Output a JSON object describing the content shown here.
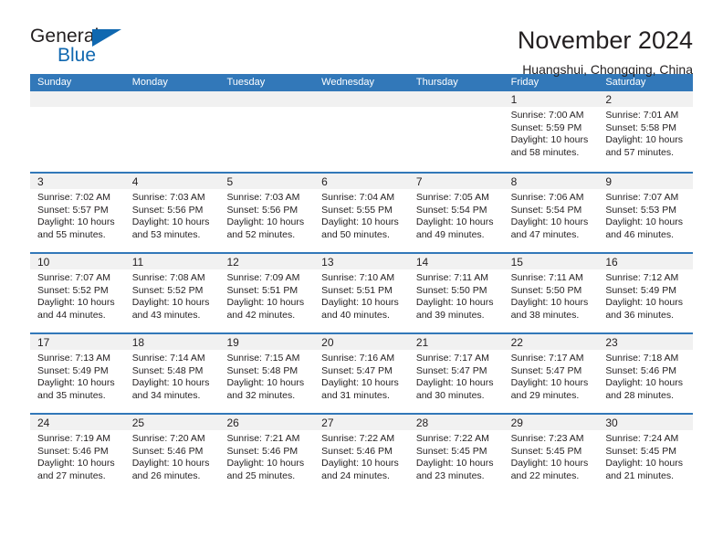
{
  "logo": {
    "line1": "General",
    "line2": "Blue",
    "triangle_icon": "blue-triangle-icon",
    "accent_color": "#1068b0"
  },
  "header": {
    "title": "November 2024",
    "location": "Huangshui, Chongqing, China"
  },
  "calendar": {
    "header_color": "#3278b9",
    "day_band_color": "#f1f1f1",
    "weekdays": [
      "Sunday",
      "Monday",
      "Tuesday",
      "Wednesday",
      "Thursday",
      "Friday",
      "Saturday"
    ],
    "labels": {
      "sunrise": "Sunrise:",
      "sunset": "Sunset:",
      "daylight": "Daylight:"
    },
    "weeks": [
      [
        {
          "day": "",
          "sunrise": "",
          "sunset": "",
          "daylight_line1": "",
          "daylight_line2": ""
        },
        {
          "day": "",
          "sunrise": "",
          "sunset": "",
          "daylight_line1": "",
          "daylight_line2": ""
        },
        {
          "day": "",
          "sunrise": "",
          "sunset": "",
          "daylight_line1": "",
          "daylight_line2": ""
        },
        {
          "day": "",
          "sunrise": "",
          "sunset": "",
          "daylight_line1": "",
          "daylight_line2": ""
        },
        {
          "day": "",
          "sunrise": "",
          "sunset": "",
          "daylight_line1": "",
          "daylight_line2": ""
        },
        {
          "day": "1",
          "sunrise": "Sunrise: 7:00 AM",
          "sunset": "Sunset: 5:59 PM",
          "daylight_line1": "Daylight: 10 hours",
          "daylight_line2": "and 58 minutes."
        },
        {
          "day": "2",
          "sunrise": "Sunrise: 7:01 AM",
          "sunset": "Sunset: 5:58 PM",
          "daylight_line1": "Daylight: 10 hours",
          "daylight_line2": "and 57 minutes."
        }
      ],
      [
        {
          "day": "3",
          "sunrise": "Sunrise: 7:02 AM",
          "sunset": "Sunset: 5:57 PM",
          "daylight_line1": "Daylight: 10 hours",
          "daylight_line2": "and 55 minutes."
        },
        {
          "day": "4",
          "sunrise": "Sunrise: 7:03 AM",
          "sunset": "Sunset: 5:56 PM",
          "daylight_line1": "Daylight: 10 hours",
          "daylight_line2": "and 53 minutes."
        },
        {
          "day": "5",
          "sunrise": "Sunrise: 7:03 AM",
          "sunset": "Sunset: 5:56 PM",
          "daylight_line1": "Daylight: 10 hours",
          "daylight_line2": "and 52 minutes."
        },
        {
          "day": "6",
          "sunrise": "Sunrise: 7:04 AM",
          "sunset": "Sunset: 5:55 PM",
          "daylight_line1": "Daylight: 10 hours",
          "daylight_line2": "and 50 minutes."
        },
        {
          "day": "7",
          "sunrise": "Sunrise: 7:05 AM",
          "sunset": "Sunset: 5:54 PM",
          "daylight_line1": "Daylight: 10 hours",
          "daylight_line2": "and 49 minutes."
        },
        {
          "day": "8",
          "sunrise": "Sunrise: 7:06 AM",
          "sunset": "Sunset: 5:54 PM",
          "daylight_line1": "Daylight: 10 hours",
          "daylight_line2": "and 47 minutes."
        },
        {
          "day": "9",
          "sunrise": "Sunrise: 7:07 AM",
          "sunset": "Sunset: 5:53 PM",
          "daylight_line1": "Daylight: 10 hours",
          "daylight_line2": "and 46 minutes."
        }
      ],
      [
        {
          "day": "10",
          "sunrise": "Sunrise: 7:07 AM",
          "sunset": "Sunset: 5:52 PM",
          "daylight_line1": "Daylight: 10 hours",
          "daylight_line2": "and 44 minutes."
        },
        {
          "day": "11",
          "sunrise": "Sunrise: 7:08 AM",
          "sunset": "Sunset: 5:52 PM",
          "daylight_line1": "Daylight: 10 hours",
          "daylight_line2": "and 43 minutes."
        },
        {
          "day": "12",
          "sunrise": "Sunrise: 7:09 AM",
          "sunset": "Sunset: 5:51 PM",
          "daylight_line1": "Daylight: 10 hours",
          "daylight_line2": "and 42 minutes."
        },
        {
          "day": "13",
          "sunrise": "Sunrise: 7:10 AM",
          "sunset": "Sunset: 5:51 PM",
          "daylight_line1": "Daylight: 10 hours",
          "daylight_line2": "and 40 minutes."
        },
        {
          "day": "14",
          "sunrise": "Sunrise: 7:11 AM",
          "sunset": "Sunset: 5:50 PM",
          "daylight_line1": "Daylight: 10 hours",
          "daylight_line2": "and 39 minutes."
        },
        {
          "day": "15",
          "sunrise": "Sunrise: 7:11 AM",
          "sunset": "Sunset: 5:50 PM",
          "daylight_line1": "Daylight: 10 hours",
          "daylight_line2": "and 38 minutes."
        },
        {
          "day": "16",
          "sunrise": "Sunrise: 7:12 AM",
          "sunset": "Sunset: 5:49 PM",
          "daylight_line1": "Daylight: 10 hours",
          "daylight_line2": "and 36 minutes."
        }
      ],
      [
        {
          "day": "17",
          "sunrise": "Sunrise: 7:13 AM",
          "sunset": "Sunset: 5:49 PM",
          "daylight_line1": "Daylight: 10 hours",
          "daylight_line2": "and 35 minutes."
        },
        {
          "day": "18",
          "sunrise": "Sunrise: 7:14 AM",
          "sunset": "Sunset: 5:48 PM",
          "daylight_line1": "Daylight: 10 hours",
          "daylight_line2": "and 34 minutes."
        },
        {
          "day": "19",
          "sunrise": "Sunrise: 7:15 AM",
          "sunset": "Sunset: 5:48 PM",
          "daylight_line1": "Daylight: 10 hours",
          "daylight_line2": "and 32 minutes."
        },
        {
          "day": "20",
          "sunrise": "Sunrise: 7:16 AM",
          "sunset": "Sunset: 5:47 PM",
          "daylight_line1": "Daylight: 10 hours",
          "daylight_line2": "and 31 minutes."
        },
        {
          "day": "21",
          "sunrise": "Sunrise: 7:17 AM",
          "sunset": "Sunset: 5:47 PM",
          "daylight_line1": "Daylight: 10 hours",
          "daylight_line2": "and 30 minutes."
        },
        {
          "day": "22",
          "sunrise": "Sunrise: 7:17 AM",
          "sunset": "Sunset: 5:47 PM",
          "daylight_line1": "Daylight: 10 hours",
          "daylight_line2": "and 29 minutes."
        },
        {
          "day": "23",
          "sunrise": "Sunrise: 7:18 AM",
          "sunset": "Sunset: 5:46 PM",
          "daylight_line1": "Daylight: 10 hours",
          "daylight_line2": "and 28 minutes."
        }
      ],
      [
        {
          "day": "24",
          "sunrise": "Sunrise: 7:19 AM",
          "sunset": "Sunset: 5:46 PM",
          "daylight_line1": "Daylight: 10 hours",
          "daylight_line2": "and 27 minutes."
        },
        {
          "day": "25",
          "sunrise": "Sunrise: 7:20 AM",
          "sunset": "Sunset: 5:46 PM",
          "daylight_line1": "Daylight: 10 hours",
          "daylight_line2": "and 26 minutes."
        },
        {
          "day": "26",
          "sunrise": "Sunrise: 7:21 AM",
          "sunset": "Sunset: 5:46 PM",
          "daylight_line1": "Daylight: 10 hours",
          "daylight_line2": "and 25 minutes."
        },
        {
          "day": "27",
          "sunrise": "Sunrise: 7:22 AM",
          "sunset": "Sunset: 5:46 PM",
          "daylight_line1": "Daylight: 10 hours",
          "daylight_line2": "and 24 minutes."
        },
        {
          "day": "28",
          "sunrise": "Sunrise: 7:22 AM",
          "sunset": "Sunset: 5:45 PM",
          "daylight_line1": "Daylight: 10 hours",
          "daylight_line2": "and 23 minutes."
        },
        {
          "day": "29",
          "sunrise": "Sunrise: 7:23 AM",
          "sunset": "Sunset: 5:45 PM",
          "daylight_line1": "Daylight: 10 hours",
          "daylight_line2": "and 22 minutes."
        },
        {
          "day": "30",
          "sunrise": "Sunrise: 7:24 AM",
          "sunset": "Sunset: 5:45 PM",
          "daylight_line1": "Daylight: 10 hours",
          "daylight_line2": "and 21 minutes."
        }
      ]
    ]
  }
}
